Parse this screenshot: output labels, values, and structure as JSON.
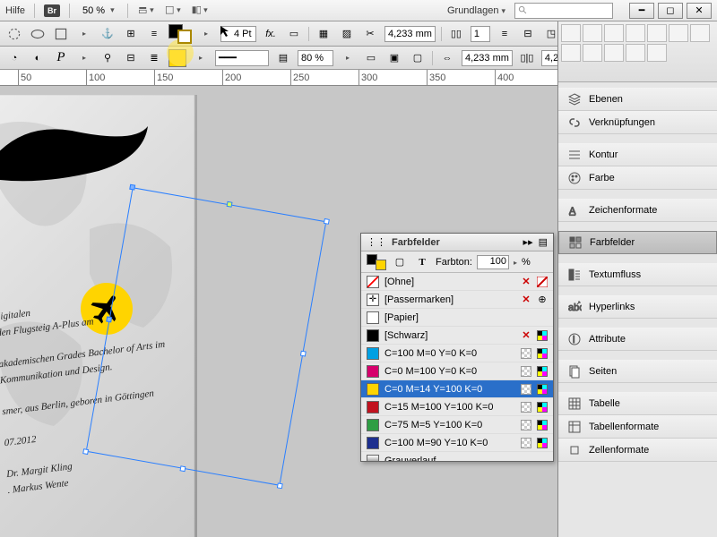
{
  "menubar": {
    "help": "Hilfe",
    "bridge_badge": "Br",
    "zoom": "50 %",
    "workspace": "Grundlagen",
    "search_placeholder": ""
  },
  "controlbar": {
    "stroke_weight": "4 Pt",
    "opacity": "80 %",
    "dim1": "4,233 mm",
    "dim2": "4,233 mm",
    "cols": "1"
  },
  "ruler": [
    "50",
    "100",
    "150",
    "200",
    "250",
    "300",
    "350",
    "400"
  ],
  "page_text": "s\n\ndigitalen\nden Flugsteig A-Plus am\n\nakademischen Grades Bachelor of Arts im\nKommunikation und Design.\n\nsmer, aus Berlin, geboren in Göttingen\n\n07.2012\n\nDr. Margit Kling\n. Markus Wente",
  "dock_panels": [
    {
      "id": "ebenen",
      "label": "Ebenen",
      "icon": "layers"
    },
    {
      "id": "verknuepfungen",
      "label": "Verknüpfungen",
      "icon": "links"
    },
    {
      "gap": true
    },
    {
      "id": "kontur",
      "label": "Kontur",
      "icon": "stroke"
    },
    {
      "id": "farbe",
      "label": "Farbe",
      "icon": "palette"
    },
    {
      "gap": true
    },
    {
      "id": "zeichenformate",
      "label": "Zeichenformate",
      "icon": "charstyle"
    },
    {
      "gap": true
    },
    {
      "id": "farbfelder",
      "label": "Farbfelder",
      "icon": "swatches",
      "selected": true
    },
    {
      "gap": true
    },
    {
      "id": "textumfluss",
      "label": "Textumfluss",
      "icon": "wrap"
    },
    {
      "gap": true
    },
    {
      "id": "hyperlinks",
      "label": "Hyperlinks",
      "icon": "hyperlink"
    },
    {
      "gap": true
    },
    {
      "id": "attribute",
      "label": "Attribute",
      "icon": "info"
    },
    {
      "gap": true
    },
    {
      "id": "seiten",
      "label": "Seiten",
      "icon": "pages"
    },
    {
      "gap": true
    },
    {
      "id": "tabelle",
      "label": "Tabelle",
      "icon": "table"
    },
    {
      "id": "tabellenformate",
      "label": "Tabellenformate",
      "icon": "tablefmt"
    },
    {
      "id": "zellenformate",
      "label": "Zellenformate",
      "icon": "cellfmt"
    }
  ],
  "swatch_panel": {
    "title": "Farbfelder",
    "tint_label": "Farbton:",
    "tint_value": "100",
    "tint_unit": "%",
    "rows": [
      {
        "name": "[Ohne]",
        "chip": "none",
        "flags": [
          "x",
          "nonecross"
        ]
      },
      {
        "name": "[Passermarken]",
        "chip": "reg",
        "flags": [
          "x",
          "reg"
        ]
      },
      {
        "name": "[Papier]",
        "chip": "#ffffff",
        "flags": []
      },
      {
        "name": "[Schwarz]",
        "chip": "#000000",
        "flags": [
          "x",
          "cmyk"
        ]
      },
      {
        "name": "C=100 M=0 Y=0 K=0",
        "chip": "#00a0e3",
        "flags": [
          "grid",
          "cmyk"
        ]
      },
      {
        "name": "C=0 M=100 Y=0 K=0",
        "chip": "#d6006c",
        "flags": [
          "grid",
          "cmyk"
        ]
      },
      {
        "name": "C=0 M=14 Y=100 K=0",
        "chip": "#ffd400",
        "flags": [
          "grid",
          "cmyk"
        ],
        "selected": true
      },
      {
        "name": "C=15 M=100 Y=100 K=0",
        "chip": "#c1121f",
        "flags": [
          "grid",
          "cmyk"
        ]
      },
      {
        "name": "C=75 M=5 Y=100 K=0",
        "chip": "#2f9e44",
        "flags": [
          "grid",
          "cmyk"
        ]
      },
      {
        "name": "C=100 M=90 Y=10 K=0",
        "chip": "#1d2f8f",
        "flags": [
          "grid",
          "cmyk"
        ]
      },
      {
        "name": "Grauverlauf",
        "chip": "linear-gradient(#fff,#555)",
        "flags": []
      }
    ]
  }
}
